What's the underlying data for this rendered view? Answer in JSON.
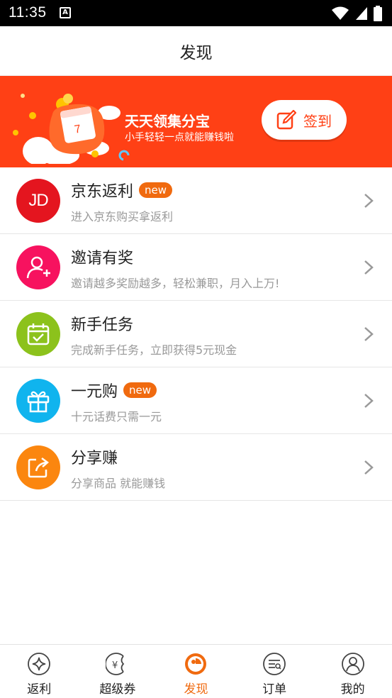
{
  "status_bar": {
    "time": "11:35",
    "notification_glyph": "A"
  },
  "header": {
    "title": "发现"
  },
  "banner": {
    "title": "天天领集分宝",
    "subtitle": "小手轻轻一点就能赚钱啦",
    "checkin_label": "签到",
    "calendar_day": "7",
    "bg_color": "#ff4015"
  },
  "items": [
    {
      "title": "京东返利",
      "badge": "new",
      "desc": "进入京东购买拿返利",
      "icon": "jd-icon",
      "icon_text": "JD",
      "color": "#e4151f"
    },
    {
      "title": "邀请有奖",
      "badge": "",
      "desc": "邀请越多奖励越多，轻松兼职，月入上万!",
      "icon": "add-user-icon",
      "color": "#f7125f"
    },
    {
      "title": "新手任务",
      "badge": "",
      "desc": "完成新手任务，立即获得5元现金",
      "icon": "calendar-check-icon",
      "color": "#8cc21c"
    },
    {
      "title": "一元购",
      "badge": "new",
      "desc": "十元话费只需一元",
      "icon": "gift-icon",
      "color": "#10b4ee"
    },
    {
      "title": "分享赚",
      "badge": "",
      "desc": "分享商品 就能赚钱",
      "icon": "share-icon",
      "color": "#fb860f"
    }
  ],
  "nav": [
    {
      "label": "返利",
      "icon": "rebate-icon",
      "active": false
    },
    {
      "label": "超级券",
      "icon": "coupon-icon",
      "active": false
    },
    {
      "label": "发现",
      "icon": "discover-icon",
      "active": true
    },
    {
      "label": "订单",
      "icon": "order-icon",
      "active": false
    },
    {
      "label": "我的",
      "icon": "profile-icon",
      "active": false
    }
  ],
  "colors": {
    "accent": "#f06a0f",
    "banner": "#ff4015"
  }
}
